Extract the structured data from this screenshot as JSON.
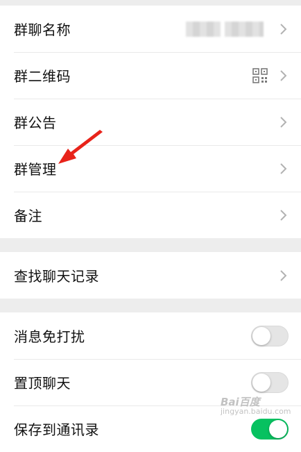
{
  "settings": {
    "group1": [
      {
        "label": "群聊名称"
      },
      {
        "label": "群二维码"
      },
      {
        "label": "群公告"
      },
      {
        "label": "群管理"
      },
      {
        "label": "备注"
      }
    ],
    "group2": [
      {
        "label": "查找聊天记录"
      }
    ],
    "group3": [
      {
        "label": "消息免打扰",
        "toggle": false
      },
      {
        "label": "置顶聊天",
        "toggle": false
      },
      {
        "label": "保存到通讯录",
        "toggle": true
      }
    ]
  },
  "watermark": {
    "line1": "Bai百度",
    "line2": "jingyan.baidu.com"
  },
  "colors": {
    "toggle_on": "#07c160",
    "toggle_off": "#e5e5e5",
    "annotation_arrow": "#e8231a"
  }
}
